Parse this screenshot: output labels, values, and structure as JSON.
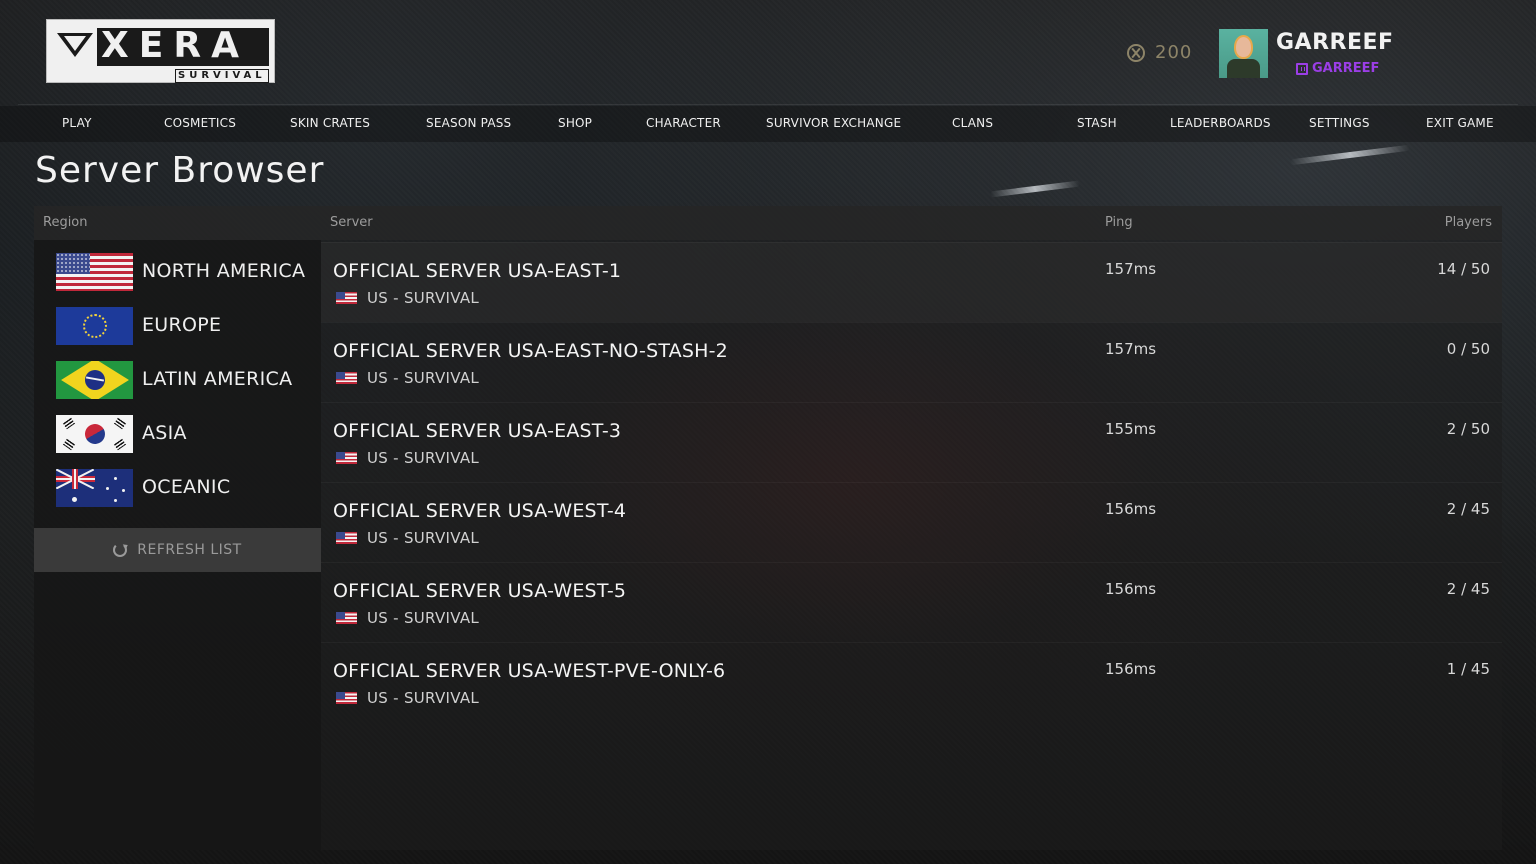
{
  "app": {
    "logo_text": "XERA",
    "logo_subtitle": "SURVIVAL"
  },
  "header": {
    "currency_amount": "200",
    "currency_icon": "coin-icon",
    "username": "GARREEF",
    "twitch_name": "GARREEF",
    "twitch_color": "#9b3ee6"
  },
  "nav": {
    "items": [
      "PLAY",
      "COSMETICS",
      "SKIN CRATES",
      "SEASON PASS",
      "SHOP",
      "CHARACTER",
      "SURVIVOR EXCHANGE",
      "CLANS",
      "STASH",
      "LEADERBOARDS",
      "SETTINGS",
      "EXIT GAME"
    ]
  },
  "page": {
    "title": "Server Browser"
  },
  "columns": {
    "region": "Region",
    "server": "Server",
    "ping": "Ping",
    "players": "Players"
  },
  "regions": [
    {
      "name": "NORTH AMERICA",
      "flag": "us-flag"
    },
    {
      "name": "EUROPE",
      "flag": "eu-flag"
    },
    {
      "name": "LATIN AMERICA",
      "flag": "brazil-flag"
    },
    {
      "name": "ASIA",
      "flag": "korea-flag"
    },
    {
      "name": "OCEANIC",
      "flag": "australia-flag"
    }
  ],
  "refresh_label": "REFRESH LIST",
  "servers": [
    {
      "name": "OFFICIAL SERVER USA-EAST-1",
      "subtitle": "US - SURVIVAL",
      "ping": "157ms",
      "players": "14 / 50"
    },
    {
      "name": "OFFICIAL SERVER USA-EAST-NO-STASH-2",
      "subtitle": "US - SURVIVAL",
      "ping": "157ms",
      "players": "0 / 50"
    },
    {
      "name": "OFFICIAL SERVER USA-EAST-3",
      "subtitle": "US - SURVIVAL",
      "ping": "155ms",
      "players": "2 / 50"
    },
    {
      "name": "OFFICIAL SERVER USA-WEST-4",
      "subtitle": "US - SURVIVAL",
      "ping": "156ms",
      "players": "2 / 45"
    },
    {
      "name": "OFFICIAL SERVER USA-WEST-5",
      "subtitle": "US - SURVIVAL",
      "ping": "156ms",
      "players": "2 / 45"
    },
    {
      "name": "OFFICIAL SERVER USA-WEST-PVE-ONLY-6",
      "subtitle": "US - SURVIVAL",
      "ping": "156ms",
      "players": "1 / 45"
    }
  ]
}
